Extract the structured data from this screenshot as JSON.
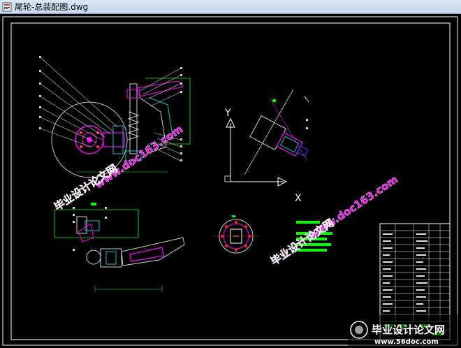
{
  "window": {
    "title": "尾轮-总装配图.dwg"
  },
  "drawing": {
    "axis_y": "Y",
    "axis_x": "X"
  },
  "watermarks": {
    "site_a_url": "www.doc163.com",
    "site_a_name": "毕业设计论文网",
    "site_b_url": "www.doc163.com",
    "site_b_name": "毕业设计论文网",
    "site_c_name": "毕业设计论文网",
    "corner_name": "毕业设计论文网",
    "corner_url": "www.56doc.com"
  },
  "colors": {
    "background": "#000000",
    "frame": "#ffffff",
    "magenta": "#ff00ff",
    "cyan": "#00c8c8",
    "green": "#00ff00",
    "red": "#ff2020",
    "blue_text": "#3344ff"
  }
}
